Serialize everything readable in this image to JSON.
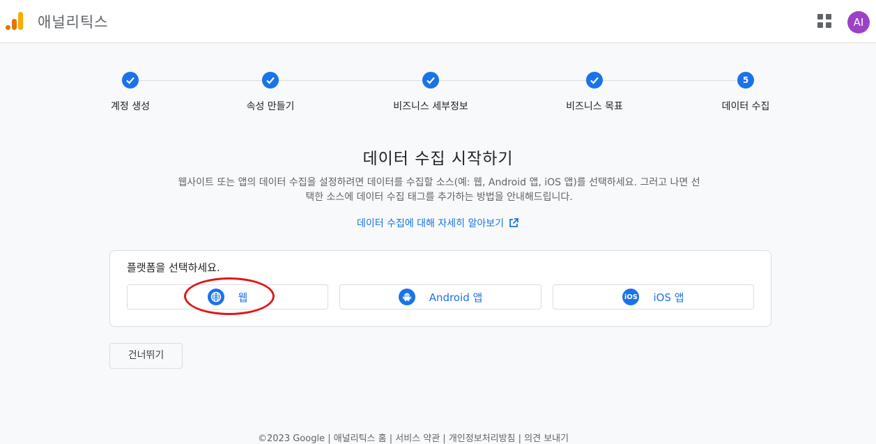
{
  "app": {
    "title": "애널리틱스",
    "avatar_initials": "AI",
    "brand_color": "#f9ab00",
    "avatar_color": "#9c42c5"
  },
  "stepper": {
    "steps": [
      {
        "label": "계정 생성",
        "state": "done"
      },
      {
        "label": "속성 만들기",
        "state": "done"
      },
      {
        "label": "비즈니스 세부정보",
        "state": "done"
      },
      {
        "label": "비즈니스 목표",
        "state": "done"
      },
      {
        "label": "데이터 수집",
        "state": "current",
        "number": "5"
      }
    ]
  },
  "main": {
    "heading": "데이터 수집 시작하기",
    "description_line1": "웹사이트 또는 앱의 데이터 수집을 설정하려면 데이터를 수집할 소스(예: 웹, Android 앱, iOS 앱)를 선택하세요. 그러고 나면 선",
    "description_line2": "택한 소스에 데이터 수집 태그를 추가하는 방법을 안내해드립니다.",
    "learn_more": "데이터 수집에 대해 자세히 알아보기",
    "platform_prompt": "플랫폼을 선택하세요.",
    "platforms": [
      {
        "label": "웹",
        "icon": "globe-icon"
      },
      {
        "label": "Android 앱",
        "icon": "android-icon",
        "icon_text": ""
      },
      {
        "label": "iOS 앱",
        "icon": "ios-icon",
        "icon_text": "iOS"
      }
    ],
    "skip_label": "건너뛰기"
  },
  "footer": {
    "text": "©2023 Google | 애널리틱스 홈 | 서비스 약관 | 개인정보처리방침 | 의견 보내기"
  },
  "colors": {
    "accent": "#1a73e8",
    "annotation": "#e0171b"
  }
}
